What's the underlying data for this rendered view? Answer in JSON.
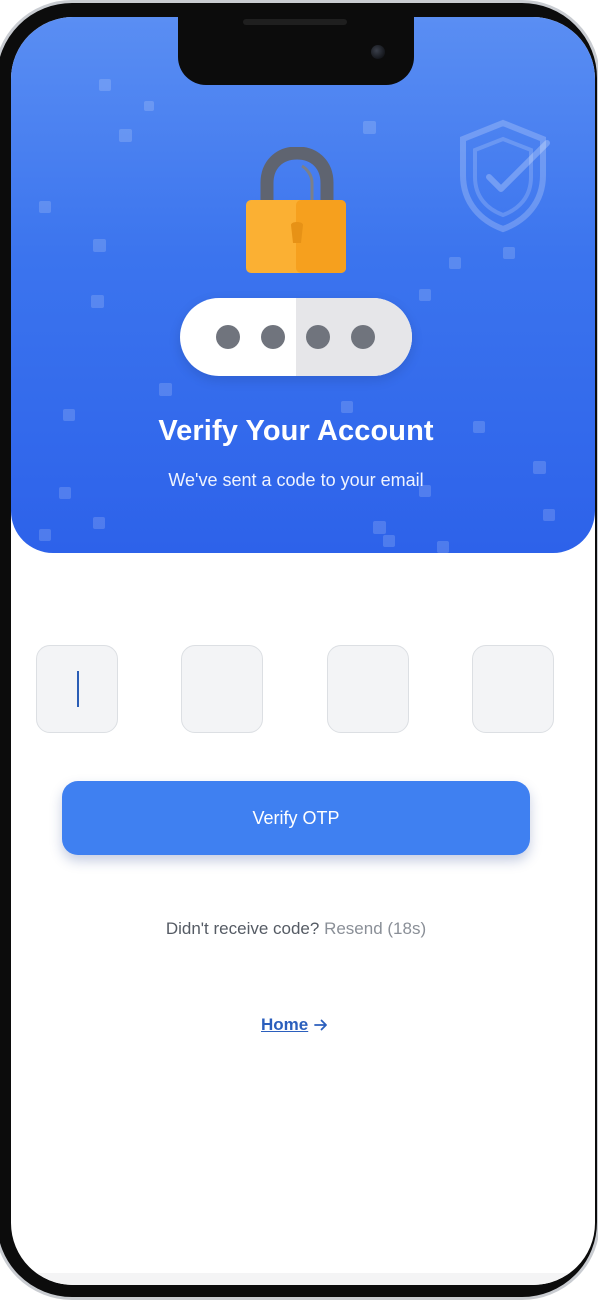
{
  "hero": {
    "title": "Verify Your Account",
    "subtitle": "We've sent a code to your email",
    "lock_icon": "padlock-icon",
    "shield_icon": "shield-check-icon",
    "pin_dots": 4
  },
  "otp": {
    "digit_count": 4,
    "values": [
      "",
      "",
      "",
      ""
    ],
    "active_index": 0
  },
  "actions": {
    "verify_label": "Verify OTP",
    "resend_prompt": "Didn't receive code?",
    "resend_label": "Resend (18s)",
    "home_label": "Home"
  },
  "colors": {
    "primary": "#3f80f1",
    "hero_top": "#5a8ef3",
    "hero_bottom": "#2d62ea",
    "lock_body": "#f9a824",
    "link": "#2b5fbd"
  }
}
